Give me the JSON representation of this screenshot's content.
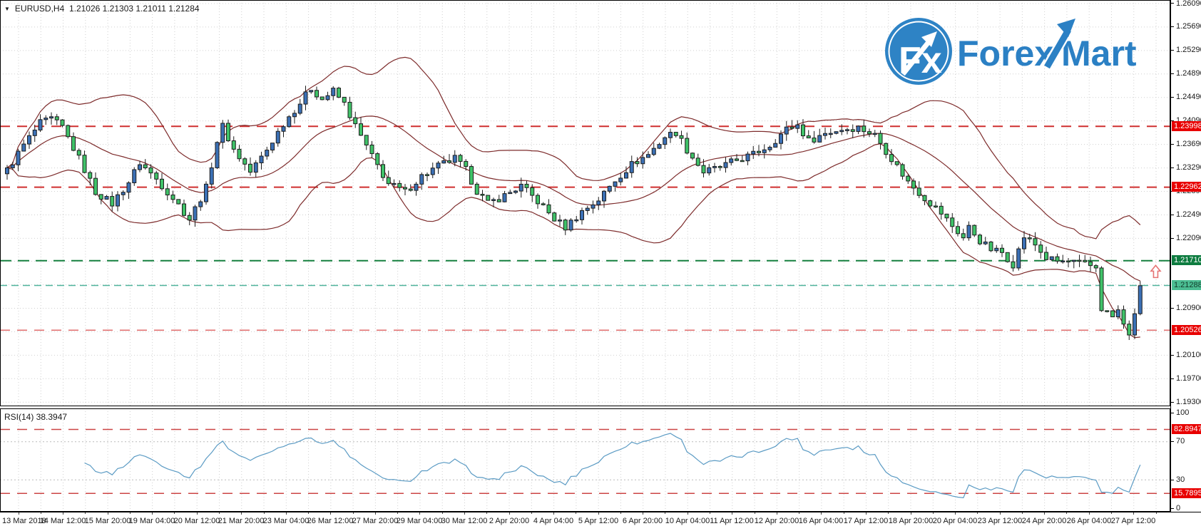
{
  "title": {
    "symbol": "EURUSD,H4",
    "ohlc": "1.21026 1.21303 1.21011 1.21284"
  },
  "icons": {
    "chart_menu": "▼",
    "logo_monogram": "Fx",
    "marker_arrow_up": "arrow-up"
  },
  "logo": {
    "part1": "Forex",
    "part2": "Mart",
    "brand_color": "#2b80c4",
    "circle_color": "#2e83c5"
  },
  "indicator_label": "RSI(14) 38.3947",
  "colors": {
    "background": "#ffffff",
    "grid": "#d0d0d0",
    "border": "#000000",
    "candle_up": "#3b70b5",
    "candle_down": "#3fc268",
    "candle_outline": "#1c1c1c",
    "bollinger": "#7d2b2b",
    "rsi_line": "#5b9bc4",
    "resistance": "#cf2f2f",
    "support_green": "#15803f",
    "bid_teal": "#4fb49c",
    "marker": "#e57373"
  },
  "chart_data": {
    "type": "candlestick",
    "symbol": "EURUSD",
    "timeframe": "H4",
    "title": "EURUSD,H4 1.21026 1.21303 1.21011 1.21284",
    "current_bar": {
      "open": 1.21026,
      "high": 1.21303,
      "low": 1.21011,
      "close": 1.21284
    },
    "bars": 206,
    "last_close": 1.21284,
    "ylim": [
      1.1923,
      1.2615
    ],
    "price_gridlines": [
      1.2609,
      1.2569,
      1.2529,
      1.2489,
      1.2449,
      1.2409,
      1.2369,
      1.2329,
      1.2289,
      1.2249,
      1.2209,
      1.217,
      1.213,
      1.209,
      1.205,
      1.201,
      1.197,
      1.193
    ],
    "price_axis_labels": [
      {
        "text": "1.26090",
        "value": 1.2609
      },
      {
        "text": "1.25690",
        "value": 1.2569
      },
      {
        "text": "1.25290",
        "value": 1.2529
      },
      {
        "text": "1.24890",
        "value": 1.2489
      },
      {
        "text": "1.24490",
        "value": 1.2449
      },
      {
        "text": "1.24090",
        "value": 1.2409
      },
      {
        "text": "1.23690",
        "value": 1.2369
      },
      {
        "text": "1.23290",
        "value": 1.2329
      },
      {
        "text": "1.22890",
        "value": 1.2289
      },
      {
        "text": "1.22490",
        "value": 1.2249
      },
      {
        "text": "1.22090",
        "value": 1.2209
      },
      {
        "text": "1.20900",
        "value": 1.209
      },
      {
        "text": "1.20100",
        "value": 1.201
      },
      {
        "text": "1.19700",
        "value": 1.197
      },
      {
        "text": "1.19300",
        "value": 1.193
      }
    ],
    "levels": [
      {
        "price": 1.23998,
        "label": "1.23998",
        "line_color": "#cf2f2f",
        "dash": "14,10",
        "width": 2,
        "label_bg": "#e80000",
        "label_fg": "#ffffff"
      },
      {
        "price": 1.22962,
        "label": "1.22962",
        "line_color": "#cf2f2f",
        "dash": "14,10",
        "width": 2,
        "label_bg": "#e80000",
        "label_fg": "#ffffff"
      },
      {
        "price": 1.2171,
        "label": "1.21710",
        "line_color": "#15803f",
        "dash": "16,9",
        "width": 2,
        "label_bg": "#0e7c40",
        "label_fg": "#ffffff"
      },
      {
        "price": 1.21288,
        "label": "1.21288",
        "line_color": "#4fb49c",
        "dash": "10,6",
        "width": 1.5,
        "label_bg": "#4bbd92",
        "label_fg": "#133d2c"
      },
      {
        "price": 1.20526,
        "label": "1.20526",
        "line_color": "#e06c6c",
        "dash": "14,10",
        "width": 1.5,
        "label_bg": "#e80000",
        "label_fg": "#ffffff"
      }
    ],
    "marker": {
      "type": "arrow-up",
      "price": 1.2152,
      "bar": 207.8,
      "color": "#e57373"
    },
    "price_path_anchors": [
      [
        0,
        1.2325
      ],
      [
        3,
        1.2368
      ],
      [
        6,
        1.2405
      ],
      [
        8,
        1.2412
      ],
      [
        10,
        1.2398
      ],
      [
        13,
        1.2345
      ],
      [
        16,
        1.2288
      ],
      [
        19,
        1.2268
      ],
      [
        22,
        1.2305
      ],
      [
        24,
        1.2338
      ],
      [
        27,
        1.231
      ],
      [
        30,
        1.2278
      ],
      [
        33,
        1.2242
      ],
      [
        36,
        1.2295
      ],
      [
        38,
        1.2375
      ],
      [
        39,
        1.24
      ],
      [
        41,
        1.236
      ],
      [
        44,
        1.2322
      ],
      [
        47,
        1.236
      ],
      [
        50,
        1.2405
      ],
      [
        53,
        1.244
      ],
      [
        55,
        1.2465
      ],
      [
        57,
        1.2446
      ],
      [
        59,
        1.246
      ],
      [
        61,
        1.2438
      ],
      [
        63,
        1.24
      ],
      [
        66,
        1.2348
      ],
      [
        69,
        1.2302
      ],
      [
        72,
        1.2288
      ],
      [
        75,
        1.2315
      ],
      [
        78,
        1.2332
      ],
      [
        81,
        1.2345
      ],
      [
        83,
        1.2325
      ],
      [
        85,
        1.229
      ],
      [
        87,
        1.2268
      ],
      [
        90,
        1.2282
      ],
      [
        93,
        1.2298
      ],
      [
        96,
        1.2272
      ],
      [
        99,
        1.2242
      ],
      [
        101,
        1.2228
      ],
      [
        104,
        1.2255
      ],
      [
        107,
        1.2275
      ],
      [
        110,
        1.2308
      ],
      [
        113,
        1.2335
      ],
      [
        116,
        1.2352
      ],
      [
        119,
        1.2382
      ],
      [
        121,
        1.239
      ],
      [
        123,
        1.236
      ],
      [
        126,
        1.2322
      ],
      [
        129,
        1.233
      ],
      [
        132,
        1.2342
      ],
      [
        135,
        1.2352
      ],
      [
        138,
        1.2368
      ],
      [
        141,
        1.2395
      ],
      [
        143,
        1.2402
      ],
      [
        145,
        1.2375
      ],
      [
        148,
        1.2388
      ],
      [
        151,
        1.2395
      ],
      [
        154,
        1.2398
      ],
      [
        157,
        1.2385
      ],
      [
        160,
        1.2345
      ],
      [
        163,
        1.2305
      ],
      [
        166,
        1.2278
      ],
      [
        169,
        1.2252
      ],
      [
        171,
        1.223
      ],
      [
        173,
        1.221
      ],
      [
        174,
        1.2228
      ],
      [
        176,
        1.2205
      ],
      [
        178,
        1.219
      ],
      [
        180,
        1.2185
      ],
      [
        182,
        1.2165
      ],
      [
        184,
        1.2212
      ],
      [
        186,
        1.2198
      ],
      [
        188,
        1.2175
      ],
      [
        190,
        1.217
      ],
      [
        193,
        1.2168
      ],
      [
        196,
        1.2162
      ],
      [
        197,
        1.216
      ],
      [
        198,
        1.209
      ],
      [
        200,
        1.2075
      ],
      [
        201,
        1.2086
      ],
      [
        202,
        1.206
      ],
      [
        203,
        1.2048
      ],
      [
        204,
        1.2075
      ],
      [
        205,
        1.21284
      ]
    ],
    "indicators": {
      "bollinger": {
        "period": 20,
        "deviation": 2,
        "color": "#7d2b2b"
      },
      "rsi": {
        "period": 14,
        "current": 38.3947,
        "label": "RSI(14) 38.3947",
        "line_color": "#5b9bc4",
        "ylim": [
          -3.5,
          105
        ],
        "levels": [
          {
            "value": 82.8947,
            "label": "82.8947",
            "line_color": "#cc4444",
            "label_bg": "#e80000",
            "label_fg": "#ffffff"
          },
          {
            "value": 15.7895,
            "label": "15.7895",
            "line_color": "#cc4444",
            "label_bg": "#e80000",
            "label_fg": "#ffffff"
          }
        ],
        "dotted_levels": [
          70,
          30
        ],
        "scale_labels": [
          {
            "text": "100",
            "value": 100
          },
          {
            "text": "70",
            "value": 70
          },
          {
            "text": "30",
            "value": 30
          },
          {
            "text": "0",
            "value": 0
          }
        ]
      }
    },
    "time_axis_labels": [
      "13 Mar 2018",
      "14 Mar 12:00",
      "15 Mar 20:00",
      "19 Mar 04:00",
      "20 Mar 12:00",
      "21 Mar 20:00",
      "23 Mar 04:00",
      "26 Mar 12:00",
      "27 Mar 20:00",
      "29 Mar 04:00",
      "30 Mar 12:00",
      "2 Apr 20:00",
      "4 Apr 04:00",
      "5 Apr 12:00",
      "6 Apr 20:00",
      "10 Apr 04:00",
      "11 Apr 12:00",
      "12 Apr 20:00",
      "16 Apr 04:00",
      "17 Apr 12:00",
      "18 Apr 20:00",
      "20 Apr 04:00",
      "23 Apr 12:00",
      "24 Apr 20:00",
      "26 Apr 04:00",
      "27 Apr 12:00"
    ]
  }
}
